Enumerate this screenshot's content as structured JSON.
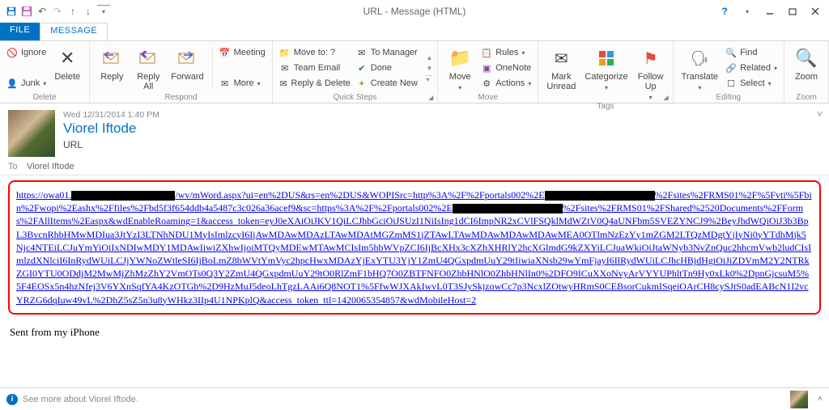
{
  "window": {
    "title": "URL - Message (HTML)"
  },
  "tabs": {
    "file": "FILE",
    "message": "MESSAGE"
  },
  "ribbon": {
    "delete_group": {
      "label": "Delete",
      "ignore": "Ignore",
      "junk": "Junk",
      "delete": "Delete"
    },
    "respond_group": {
      "label": "Respond",
      "reply": "Reply",
      "reply_all": "Reply\nAll",
      "forward": "Forward",
      "meeting": "Meeting",
      "more": "More"
    },
    "quicksteps_group": {
      "label": "Quick Steps",
      "move_to": "Move to: ?",
      "team_email": "Team Email",
      "reply_delete": "Reply & Delete",
      "to_manager": "To Manager",
      "done": "Done",
      "create_new": "Create New"
    },
    "move_group": {
      "label": "Move",
      "move": "Move",
      "rules": "Rules",
      "onenote": "OneNote",
      "actions": "Actions"
    },
    "tags_group": {
      "label": "Tags",
      "mark_unread": "Mark\nUnread",
      "categorize": "Categorize",
      "follow_up": "Follow\nUp"
    },
    "editing_group": {
      "label": "Editing",
      "translate": "Translate",
      "find": "Find",
      "related": "Related",
      "select": "Select"
    },
    "zoom_group": {
      "label": "Zoom",
      "zoom": "Zoom"
    }
  },
  "message_header": {
    "date": "Wed 12/31/2014 1:40 PM",
    "sender": "Viorel Iftode",
    "subject": "URL",
    "to_label": "To",
    "to_value": "Viorel Iftode"
  },
  "body": {
    "url_parts": [
      "https://owa01.",
      "/wv/mWord.aspx?ui=en%2DUS&rs=en%2DUS&WOPISrc=http%3A%2F%2Fportals002%2E",
      "%2Fsites%2FRMS01%2F%5Fvti%5Fbin%2Fwopi%2Eashx%2Ffiles%2Fbd5f3f654ddb4a5487c3c026a36acef9&sc=https%3A%2F%2Fportals002%2E",
      "%2Fsites%2FRMS01%2FShared%2520Documents%2FForms%2FAllItems%2Easpx&wdEnableRoaming=1&access_token=eyJ0eXAiOiJKV1QiLCJhbGciOiJSUzI1NiIsIng1dCI6ImpNR2xCVlFSQklMdWZtV0Q4aUNFbm5SVEZYNCJ9%2BeyJhdWQiOiJ3b3BpL3BvcnRhbHMwMDIua3JtYzI3LTNhNDU1MyIsImlzcyI6IjAwMDAwMDAzLTAwMDAtMGZmMS1jZTAwLTAwMDAwMDAwMDAwMEA0OTlmNzEzYy1mZGM2LTQzMDgtYjIyNi0yYTdhMjk5Njc4NTEiLCJuYmYiOiIxNDIwMDY1MDAwIiwiZXhwIjoiMTQyMDEwMTAwMCIsIm5hbWVpZCI6IjBcXHx3cXZhXHRlY2hcXGlmdG9kZXYiLCJuaWkiOiJtaWNyb3NvZnQuc2hhcmVwb2ludCIsImlzdXNlciI6InRydWUiLCJjYWNoZWtleSI6IjBoLmZ8bWVtYmVyc2hpcHwxMDAzYjExYTU3YjY1ZmU4QGxpdmUuY29tIiwiaXNsb29wYmFjayI6IlRydWUiLCJhcHBjdHgiOiJiZDVmM2Y2NTRkZGI0YTU0ODdjM2MwMjZhMzZhY2VmOTs0Q3Y2ZmU4QGxpdmUuY29tO0RlZmF1bHQ7O0ZBTFNFO0ZhbHNlO0ZhbHNlIn0%2DFO9ICuXXoNvyArVYYUPhltTn9Hy0xLk0%2DpnGjcsuM5%5F4EOSx5n4hzNfej3V6YXnSqfYA4KzOTGb%2D9HzMuJ5deoLhTgzLAAi6Q8NOT1%5FfwWJXAkIwvL0T3SJySkjzowCc7p3NcxlZOtwyHRmS0CEBsorCukmISqeiOArCH8cySJtS0adEABcN1I2vcYRZG6dqIuw49vL%2DhZ5sZ5n3u8yWHkz3IIp4U1NPKplQ&access_token_ttl=1420065354857&wdMobileHost=2"
    ],
    "url_redact_widths": [
      128,
      136,
      136
    ],
    "signature": "Sent from my iPhone"
  },
  "people_pane": {
    "text": "See more about Viorel Iftode."
  }
}
